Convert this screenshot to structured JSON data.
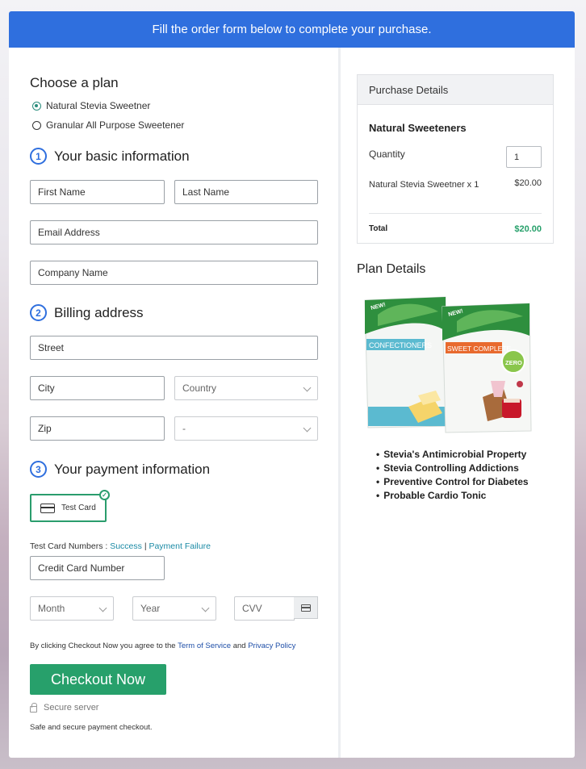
{
  "banner": {
    "text": "Fill the order form below to complete your purchase."
  },
  "plan": {
    "heading": "Choose a plan",
    "options": [
      {
        "label": "Natural Stevia Sweetner",
        "selected": true
      },
      {
        "label": "Granular All Purpose Sweetener",
        "selected": false
      }
    ]
  },
  "basic": {
    "step": "1",
    "heading": "Your basic information",
    "first_name": "First Name",
    "last_name": "Last Name",
    "email": "Email Address",
    "company": "Company Name"
  },
  "billing": {
    "step": "2",
    "heading": "Billing address",
    "street": "Street",
    "city": "City",
    "country": "Country",
    "zip": "Zip",
    "state": "-"
  },
  "payment": {
    "step": "3",
    "heading": "Your payment information",
    "test_card_label": "Test Card",
    "test_numbers_label": "Test Card Numbers :",
    "success_link": "Success",
    "separator": "|",
    "failure_link": "Payment Failure",
    "card_number": "Credit Card Number",
    "month": "Month",
    "year": "Year",
    "cvv": "CVV"
  },
  "terms": {
    "prefix": "By clicking Checkout Now you agree to the",
    "terms_link": "Term of Service",
    "and": "and",
    "privacy_link": "Privacy Policy"
  },
  "checkout": {
    "button": "Checkout Now",
    "secure": "Secure server",
    "note": "Safe and secure payment checkout."
  },
  "purchase": {
    "heading": "Purchase Details",
    "product_title": "Natural Sweeteners",
    "quantity_label": "Quantity",
    "quantity_value": "1",
    "item": "Natural Stevia Sweetner x 1",
    "item_price": "$20.00",
    "total_label": "Total",
    "total_value": "$20.00"
  },
  "plan_details": {
    "heading": "Plan Details",
    "bag_left_text": "CONFECTIONERS",
    "bag_right_text": "SWEET COMPLETE",
    "bag_badge": "ZERO",
    "bag_new": "NEW!",
    "features": [
      "Stevia's Antimicrobial Property",
      "Stevia Controlling Addictions",
      "Preventive Control for Diabetes",
      "Probable Cardio Tonic"
    ]
  },
  "colors": {
    "brand_blue": "#2f6fde",
    "accent_green": "#27a06b",
    "link_teal": "#1a8aa5"
  }
}
